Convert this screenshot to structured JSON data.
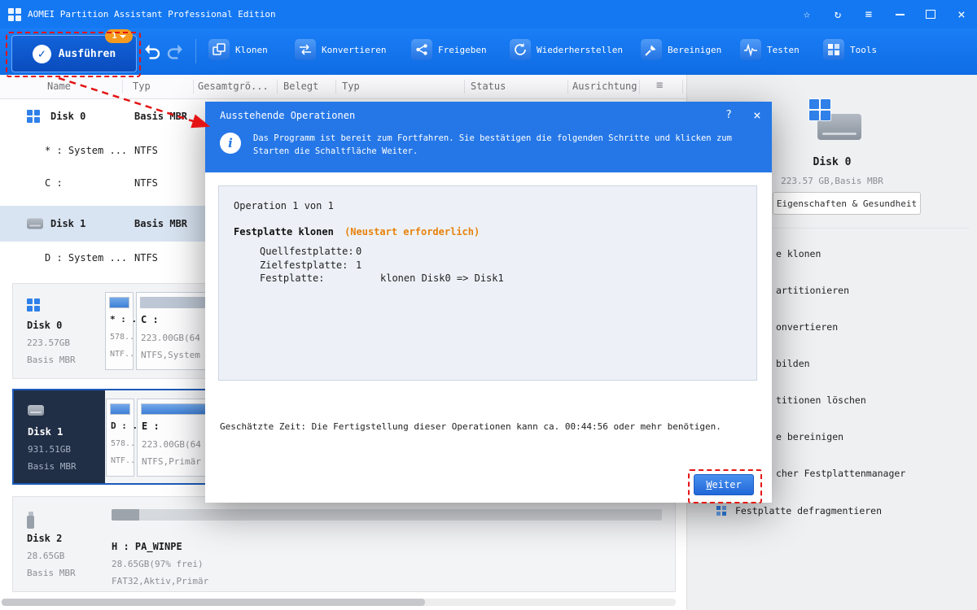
{
  "window": {
    "title": "AOMEI Partition Assistant Professional Edition"
  },
  "titlebar_icons": {
    "star": "☆",
    "sync": "↻",
    "menu": "≡",
    "close": "×"
  },
  "toolbar": {
    "apply_label": "Ausführen",
    "apply_badge": "1",
    "apply_check": "✓",
    "buttons": [
      {
        "label": "Klonen"
      },
      {
        "label": "Konvertieren"
      },
      {
        "label": "Freigeben"
      },
      {
        "label": "Wiederherstellen"
      },
      {
        "label": "Bereinigen"
      },
      {
        "label": "Testen"
      },
      {
        "label": "Tools"
      }
    ]
  },
  "table": {
    "columns": [
      "Name",
      "Typ",
      "Gesamtgrö...",
      "Belegt",
      "Typ",
      "Status",
      "Ausrichtung"
    ],
    "options_icon": "≡",
    "rows": [
      {
        "name": "Disk 0",
        "typ": "Basis MBR"
      },
      {
        "name": "* : System ...",
        "typ": "NTFS"
      },
      {
        "name": "C :",
        "typ": "NTFS"
      },
      {
        "name": "Disk 1",
        "typ": "Basis MBR"
      },
      {
        "name": "D : System ...",
        "typ": "NTFS"
      }
    ]
  },
  "disks": [
    {
      "name": "Disk 0",
      "size": "223.57GB",
      "scheme": "Basis MBR",
      "partitions": [
        {
          "label": "* : ...",
          "size": "578...",
          "fs": "NTF..."
        },
        {
          "label": "C :",
          "size": "223.00GB(64",
          "fs": "NTFS,System"
        }
      ]
    },
    {
      "name": "Disk 1",
      "size": "931.51GB",
      "scheme": "Basis MBR",
      "partitions": [
        {
          "label": "D : ...",
          "size": "578...",
          "fs": "NTF..."
        },
        {
          "label": "E :",
          "size": "223.00GB(64",
          "fs": "NTFS,Primär"
        }
      ]
    },
    {
      "name": "Disk 2",
      "size": "28.65GB",
      "scheme": "Basis MBR",
      "partitions": [
        {
          "label": "H : PA_WINPE",
          "size": "28.65GB(97% frei)",
          "fs": "FAT32,Aktiv,Primär"
        }
      ]
    }
  ],
  "dialog": {
    "title": "Ausstehende Operationen",
    "help": "?",
    "close": "×",
    "info_icon": "i",
    "info_text": "Das Programm ist bereit zum Fortfahren. Sie bestätigen die folgenden Schritte und klicken zum Starten die Schaltfläche Weiter.",
    "operation_count": "Operation 1 von 1",
    "operation_title": "Festplatte klonen",
    "operation_note": "(Neustart erforderlich)",
    "details": [
      {
        "label": "Quellfestplatte:",
        "value": "0"
      },
      {
        "label": "Zielfestplatte:",
        "value": "1"
      },
      {
        "label": "Festplatte:",
        "value": "klonen Disk0 => Disk1"
      }
    ],
    "estimate": "Geschätzte Zeit: Die Fertigstellung dieser Operationen kann ca. 00:44:56 oder mehr benötigen.",
    "proceed_accesskey": "W",
    "proceed_rest": "eiter"
  },
  "right_panel": {
    "disk_name": "Disk 0",
    "disk_info": "223.57 GB,Basis MBR",
    "properties_button": "Eigenschaften & Gesundheit",
    "menu_items": [
      {
        "label": "e klonen"
      },
      {
        "label": "artitionieren"
      },
      {
        "label": "onvertieren"
      },
      {
        "label": "bilden"
      },
      {
        "label": "titionen löschen"
      },
      {
        "label": "e bereinigen"
      },
      {
        "label": "cher Festplattenmanager"
      },
      {
        "label": "Festplatte defragmentieren"
      }
    ]
  },
  "colors": {
    "accent_blue": "#1478f2",
    "dialog_header_blue": "#2577e7",
    "warning_orange": "#e8820c",
    "annotation_red": "#e41414"
  }
}
